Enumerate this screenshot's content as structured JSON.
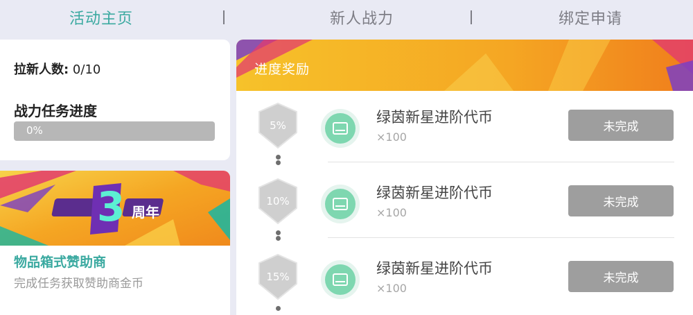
{
  "tabs": [
    {
      "label": "活动主页",
      "active": true
    },
    {
      "label": "新人战力",
      "active": false
    },
    {
      "label": "绑定申请",
      "active": false
    }
  ],
  "stats": {
    "invite_label": "拉新人数:",
    "invite_value": " 0/10",
    "task_title": "战力任务进度",
    "progress_text": "0%",
    "progress_value": 0
  },
  "promo": {
    "banner_text": "3",
    "banner_subtext": "周年",
    "title": "物品箱式赞助商",
    "description": "完成任务获取赞助商金币"
  },
  "rewards": {
    "header_title": "进度奖励",
    "items": [
      {
        "percent": "5%",
        "name": "绿茵新星进阶代币",
        "qty": "×100",
        "status": "未完成"
      },
      {
        "percent": "10%",
        "name": "绿茵新星进阶代币",
        "qty": "×100",
        "status": "未完成"
      },
      {
        "percent": "15%",
        "name": "绿茵新星进阶代币",
        "qty": "×100",
        "status": "未完成"
      }
    ]
  },
  "colors": {
    "accent": "#3aa9a0",
    "button_disabled": "#9e9e9e",
    "badge": "#cfcfcf",
    "coin": "#7ed7b0",
    "header_orange": "#f7a928"
  }
}
